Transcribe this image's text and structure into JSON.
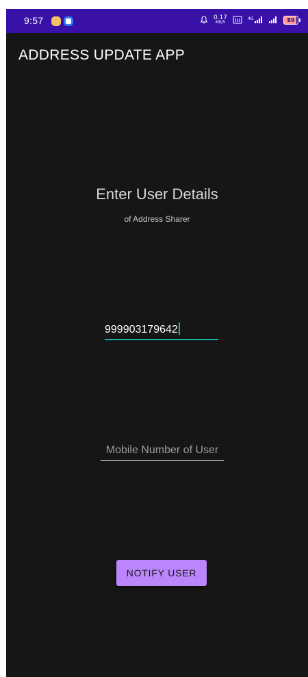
{
  "status_bar": {
    "time": "9:57",
    "net_speed_value": "0.17",
    "net_speed_unit": "KB/S",
    "battery_level": "89",
    "icons": [
      "notification-app-icon",
      "notification-app-icon",
      "alarm-bell-icon",
      "volte-icon",
      "signal-4g-icon",
      "signal-icon",
      "battery-icon"
    ],
    "colors": {
      "background": "#3a11a8"
    }
  },
  "app_bar": {
    "title": "ADDRESS UPDATE APP"
  },
  "main": {
    "heading": "Enter User Details",
    "subheading": "of Address Sharer",
    "id_field": {
      "value": "999903179642",
      "underline_color": "#17b3a8"
    },
    "mobile_field": {
      "placeholder": "Mobile Number of User",
      "value": ""
    },
    "notify_button": {
      "label": "NOTIFY USER",
      "color": "#bb86fc"
    }
  },
  "theme": {
    "background": "#161616",
    "accent": "#bb86fc"
  }
}
